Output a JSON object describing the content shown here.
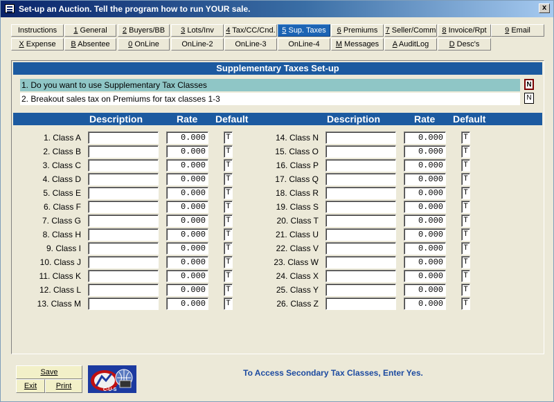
{
  "window": {
    "title": "Set-up an Auction.  Tell the program how to run YOUR sale.",
    "close_label": "x"
  },
  "tabs_row1": [
    {
      "key": "",
      "label": "Instructions",
      "active": false
    },
    {
      "key": "1",
      "label": " General",
      "active": false
    },
    {
      "key": "2",
      "label": " Buyers/BB",
      "active": false
    },
    {
      "key": "3",
      "label": " Lots/Inv",
      "active": false
    },
    {
      "key": "4",
      "label": " Tax/CC/Cnd.",
      "active": false
    },
    {
      "key": "5",
      "label": " Sup. Taxes",
      "active": true
    },
    {
      "key": "6",
      "label": " Premiums",
      "active": false
    },
    {
      "key": "7",
      "label": " Seller/Comm",
      "active": false
    },
    {
      "key": "8",
      "label": " Invoice/Rpt",
      "active": false
    },
    {
      "key": "9",
      "label": " Email",
      "active": false
    }
  ],
  "tabs_row2": [
    {
      "key": "X",
      "label": " Expense"
    },
    {
      "key": "B",
      "label": " Absentee"
    },
    {
      "key": "0",
      "label": " OnLine"
    },
    {
      "key": "",
      "label": "OnLine-2"
    },
    {
      "key": "",
      "label": "OnLine-3"
    },
    {
      "key": "",
      "label": "OnLine-4"
    },
    {
      "key": "M",
      "label": " Messages"
    },
    {
      "key": "A",
      "label": " AuditLog"
    },
    {
      "key": "D",
      "label": " Desc's"
    }
  ],
  "panel": {
    "title": "Supplementary Taxes Set-up",
    "question1": "1. Do you want to use Supplementary Tax Classes",
    "question1_value": "N",
    "question2": "2. Breakout sales tax on Premiums for tax classes 1-3",
    "question2_value": "N"
  },
  "columns": {
    "description": "Description",
    "rate": "Rate",
    "default": "Default"
  },
  "classes_left": [
    {
      "label": "1. Class A",
      "rate": "0.000",
      "default": "T"
    },
    {
      "label": "2. Class B",
      "rate": "0.000",
      "default": "T"
    },
    {
      "label": "3. Class C",
      "rate": "0.000",
      "default": "T"
    },
    {
      "label": "4. Class D",
      "rate": "0.000",
      "default": "T"
    },
    {
      "label": "5. Class E",
      "rate": "0.000",
      "default": "T"
    },
    {
      "label": "6. Class F",
      "rate": "0.000",
      "default": "T"
    },
    {
      "label": "7. Class G",
      "rate": "0.000",
      "default": "T"
    },
    {
      "label": "8. Class H",
      "rate": "0.000",
      "default": "T"
    },
    {
      "label": "9. Class I",
      "rate": "0.000",
      "default": "T"
    },
    {
      "label": "10. Class J",
      "rate": "0.000",
      "default": "T"
    },
    {
      "label": "11. Class K",
      "rate": "0.000",
      "default": "T"
    },
    {
      "label": "12. Class L",
      "rate": "0.000",
      "default": "T"
    },
    {
      "label": "13. Class M",
      "rate": "0.000",
      "default": "T"
    }
  ],
  "classes_right": [
    {
      "label": "14. Class N",
      "rate": "0.000",
      "default": "T"
    },
    {
      "label": "15. Class O",
      "rate": "0.000",
      "default": "T"
    },
    {
      "label": "16. Class P",
      "rate": "0.000",
      "default": "T"
    },
    {
      "label": "17. Class Q",
      "rate": "0.000",
      "default": "T"
    },
    {
      "label": "18. Class R",
      "rate": "0.000",
      "default": "T"
    },
    {
      "label": "19. Class S",
      "rate": "0.000",
      "default": "T"
    },
    {
      "label": "20. Class T",
      "rate": "0.000",
      "default": "T"
    },
    {
      "label": "21. Class U",
      "rate": "0.000",
      "default": "T"
    },
    {
      "label": "22. Class V",
      "rate": "0.000",
      "default": "T"
    },
    {
      "label": "23. Class W",
      "rate": "0.000",
      "default": "T"
    },
    {
      "label": "24. Class X",
      "rate": "0.000",
      "default": "T"
    },
    {
      "label": "25. Class Y",
      "rate": "0.000",
      "default": "T"
    },
    {
      "label": "26. Class Z",
      "rate": "0.000",
      "default": "T"
    }
  ],
  "buttons": {
    "save": "Save",
    "exit": "Exit",
    "print": "Print"
  },
  "logo_text": "C-U-S",
  "status_message": "To Access Secondary Tax Classes, Enter Yes."
}
